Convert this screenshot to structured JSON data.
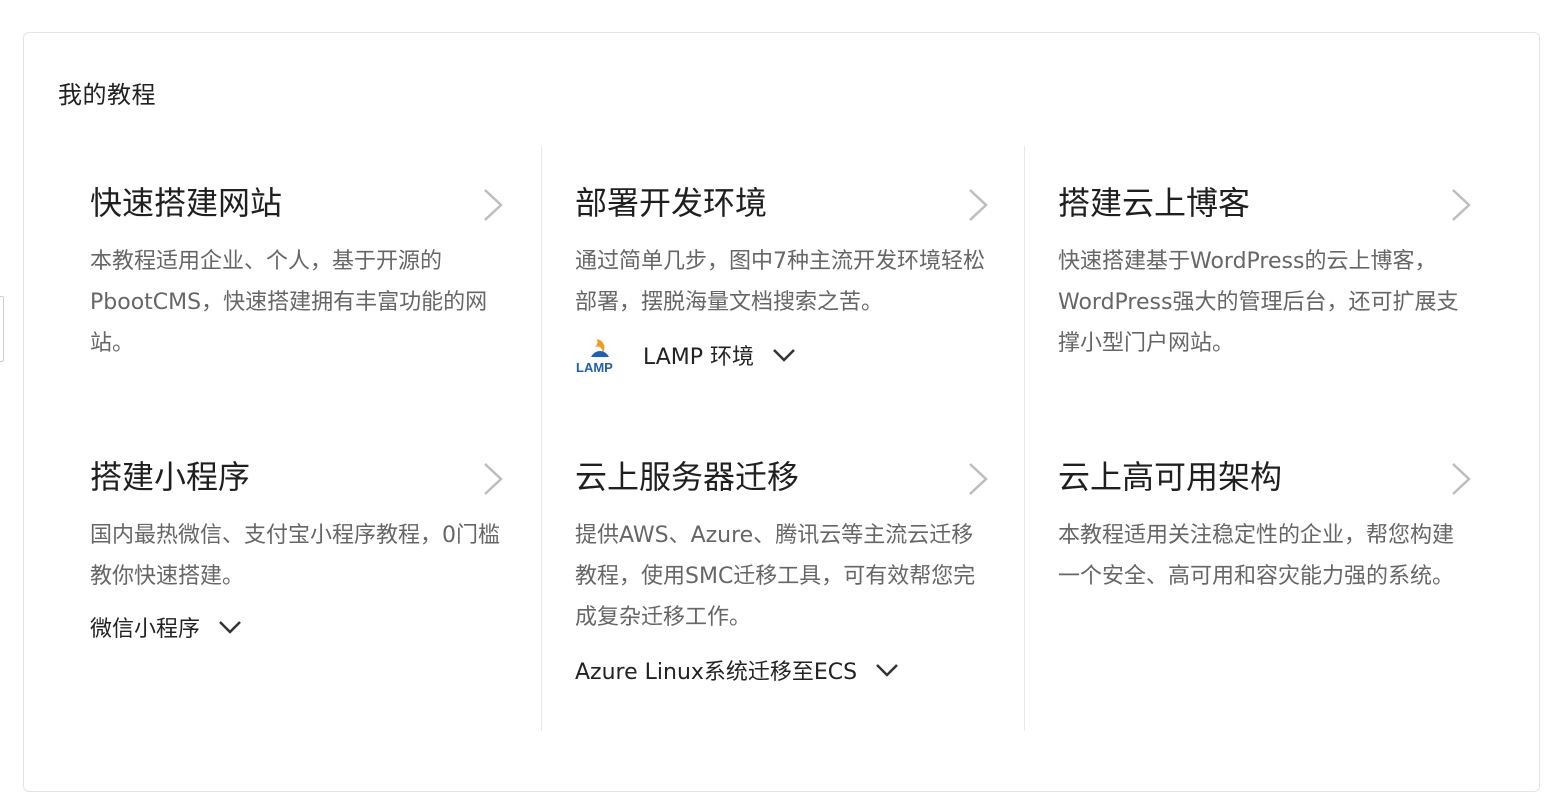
{
  "section": {
    "title": "我的教程"
  },
  "cards": [
    {
      "title": "快速搭建网站",
      "description": "本教程适用企业、个人，基于开源的PbootCMS，快速搭建拥有丰富功能的网站。",
      "link": ""
    },
    {
      "title": "部署开发环境",
      "description": "通过简单几步，图中7种主流开发环境轻松部署，摆脱海量文档搜索之苦。",
      "link": "LAMP 环境",
      "link_logo_text": "LAMP",
      "link_logo_icon": "lamp-logo-icon"
    },
    {
      "title": "搭建云上博客",
      "description": "快速搭建基于WordPress的云上博客，WordPress强大的管理后台，还可扩展支撑小型门户网站。",
      "link": ""
    },
    {
      "title": "搭建小程序",
      "description": "国内最热微信、支付宝小程序教程，0门槛教你快速搭建。",
      "link": "微信小程序"
    },
    {
      "title": "云上服务器迁移",
      "description": "提供AWS、Azure、腾讯云等主流云迁移教程，使用SMC迁移工具，可有效帮您完成复杂迁移工作。",
      "link": "Azure Linux系统迁移至ECS"
    },
    {
      "title": "云上高可用架构",
      "description": "本教程适用关注稳定性的企业，帮您构建一个安全、高可用和容灾能力强的系统。",
      "link": ""
    }
  ],
  "icons": {
    "arrow": "chevron-right-icon",
    "dropdown": "chevron-down-icon"
  },
  "colors": {
    "title": "#1f1f1f",
    "description": "#666666",
    "arrow": "#bdbdbd",
    "border": "#e3e3e3",
    "lamp_blue": "#1e5fb8",
    "lamp_orange": "#f39a1e"
  }
}
